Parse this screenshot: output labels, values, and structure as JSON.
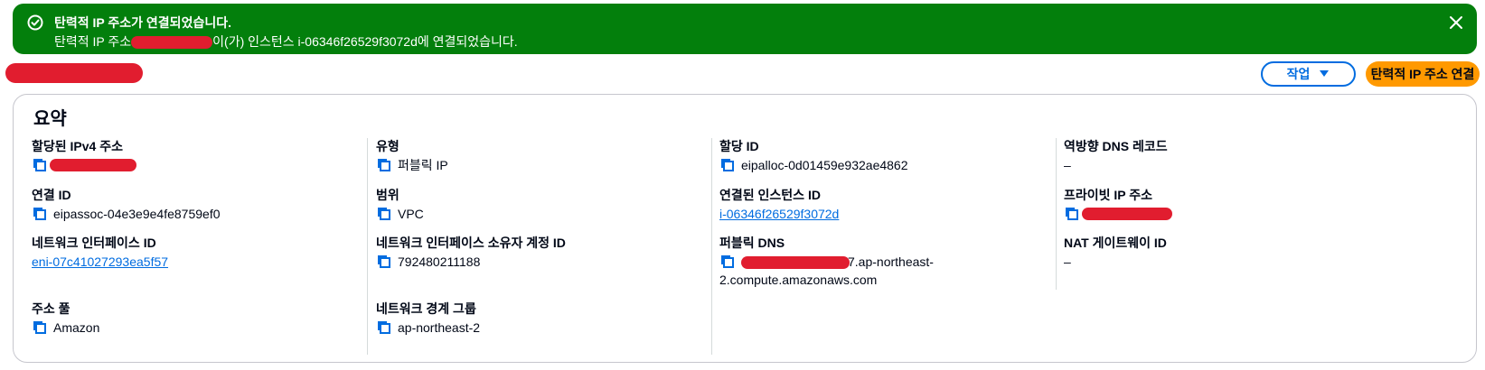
{
  "flash": {
    "title": "탄력적 IP 주소가 연결되었습니다.",
    "message_prefix": "탄력적 IP 주소",
    "message_suffix": "이(가) 인스턴스 i-06346f26529f3072d에 연결되었습니다.",
    "colors": {
      "background": "#037f0c",
      "text": "#ffffff"
    },
    "icons": {
      "status": "success-check-circle-icon",
      "close": "close-icon"
    }
  },
  "header": {
    "actions_label": "작업",
    "associate_label": "탄력적 IP 주소 연결"
  },
  "summary": {
    "title": "요약",
    "col1": {
      "assigned_ipv4_label": "할당된 IPv4 주소",
      "association_id_label": "연결 ID",
      "association_id_value": "eipassoc-04e3e9e4fe8759ef0",
      "network_interface_id_label": "네트워크 인터페이스 ID",
      "network_interface_id_value": "eni-07c41027293ea5f57",
      "address_pool_label": "주소 풀",
      "address_pool_value": "Amazon"
    },
    "col2": {
      "type_label": "유형",
      "type_value": "퍼블릭 IP",
      "scope_label": "범위",
      "scope_value": "VPC",
      "owner_account_label": "네트워크 인터페이스 소유자 계정 ID",
      "owner_account_value": "792480211188",
      "border_group_label": "네트워크 경계 그룹",
      "border_group_value": "ap-northeast-2"
    },
    "col3": {
      "allocation_id_label": "할당 ID",
      "allocation_id_value": "eipalloc-0d01459e932ae4862",
      "instance_id_label": "연결된 인스턴스 ID",
      "instance_id_value": "i-06346f26529f3072d",
      "public_dns_label": "퍼블릭 DNS",
      "public_dns_line1_suffix": "7.ap-northeast-",
      "public_dns_line2": "2.compute.amazonaws.com"
    },
    "col4": {
      "reverse_dns_label": "역방향 DNS 레코드",
      "reverse_dns_value": "–",
      "private_ip_label": "프라이빗 IP 주소",
      "nat_gateway_label": "NAT 게이트웨이 ID",
      "nat_gateway_value": "–"
    }
  },
  "theme": {
    "link": "#006ce0",
    "primary_button": "#ff9900",
    "redaction": "#e11d2f",
    "border": "#c6c6cd"
  }
}
